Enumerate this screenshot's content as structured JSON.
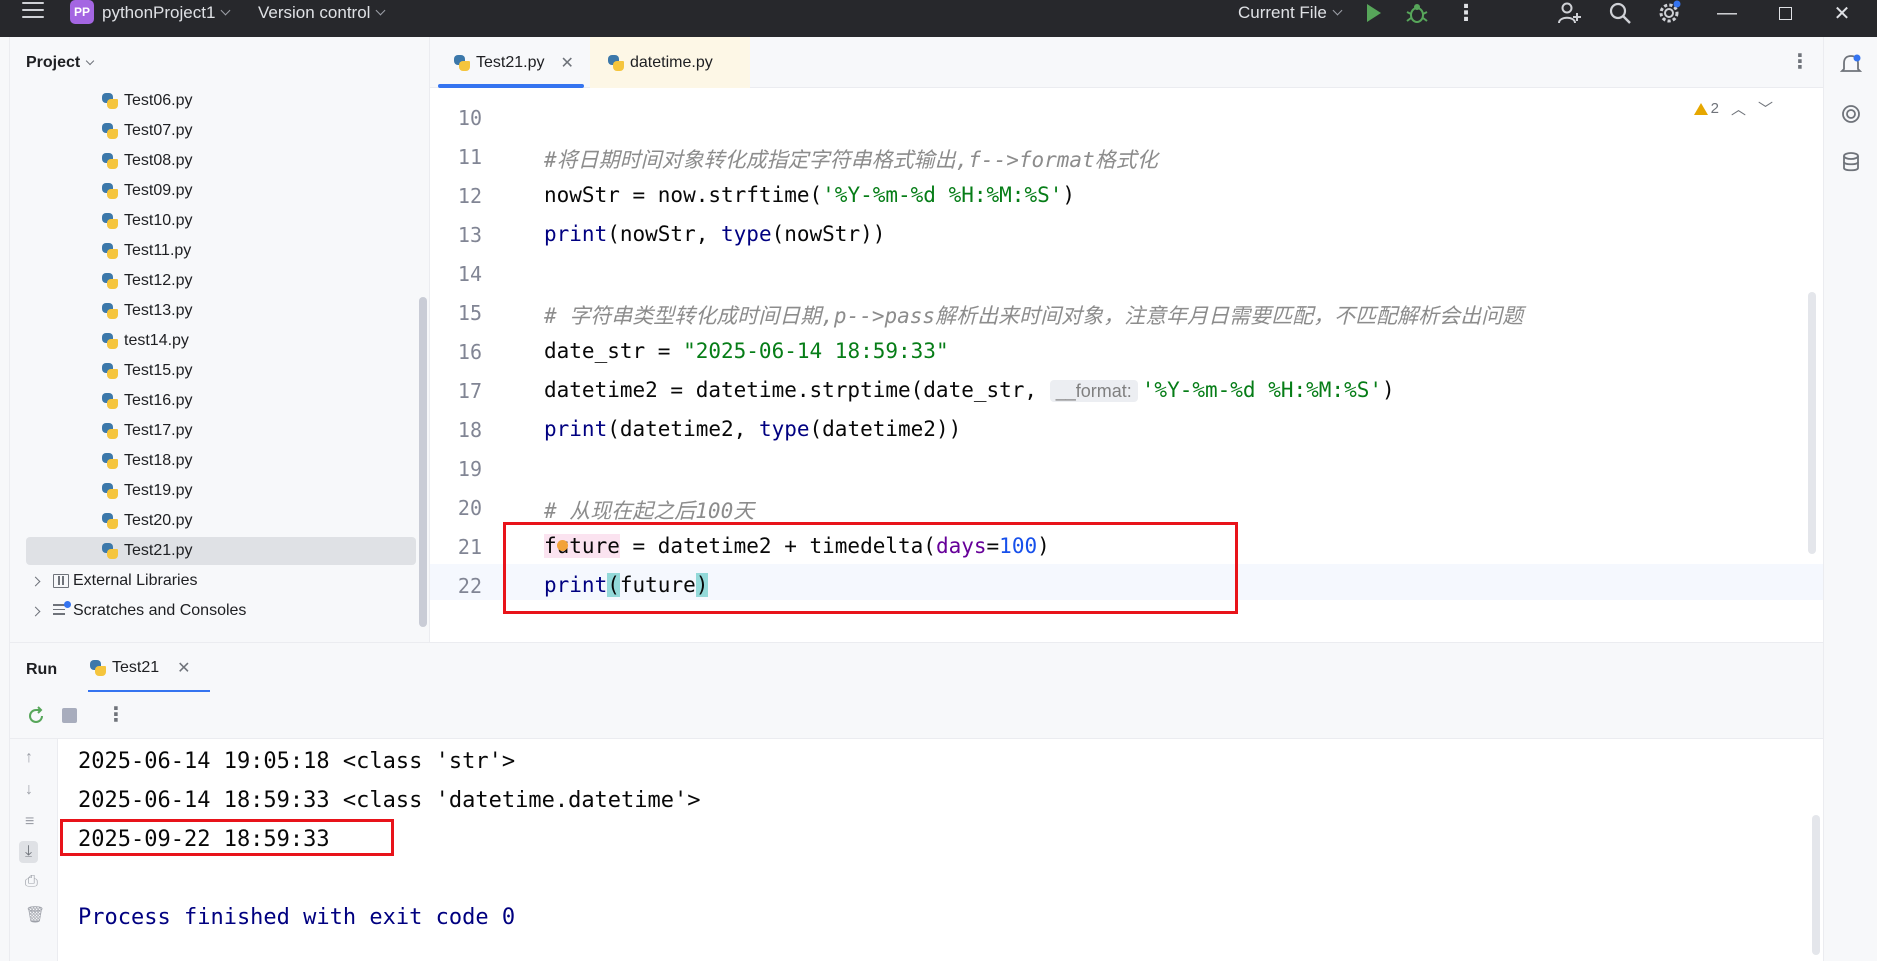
{
  "titlebar": {
    "project_badge": "PP",
    "project_name": "pythonProject1",
    "version_control": "Version control",
    "run_config": "Current File"
  },
  "project_panel": {
    "title": "Project",
    "files": [
      "Test06.py",
      "Test07.py",
      "Test08.py",
      "Test09.py",
      "Test10.py",
      "Test11.py",
      "Test12.py",
      "Test13.py",
      "test14.py",
      "Test15.py",
      "Test16.py",
      "Test17.py",
      "Test18.py",
      "Test19.py",
      "Test20.py",
      "Test21.py"
    ],
    "selected_file": "Test21.py",
    "external_libraries": "External Libraries",
    "scratches": "Scratches and Consoles"
  },
  "editor": {
    "tabs": [
      {
        "label": "Test21.py",
        "active": true
      },
      {
        "label": "datetime.py",
        "active": false
      }
    ],
    "warning_count": "2",
    "line_numbers": [
      "10",
      "11",
      "12",
      "13",
      "14",
      "15",
      "16",
      "17",
      "18",
      "19",
      "20",
      "21",
      "22"
    ],
    "lines": {
      "l11_comment": "#将日期时间对象转化成指定字符串格式输出,f-->format格式化",
      "l12_a": "nowStr = now.strftime(",
      "l12_str": "'%Y-%m-%d %H:%M:%S'",
      "l12_b": ")",
      "l13_kw": "print",
      "l13_a": "(nowStr, ",
      "l13_kw2": "type",
      "l13_b": "(nowStr))",
      "l15_comment": "# 字符串类型转化成时间日期,p-->pass解析出来时间对象，注意年月日需要匹配，不匹配解析会出问题",
      "l16_a": "date_str = ",
      "l16_str": "\"2025-06-14 18:59:33\"",
      "l17_a": "datetime2 = datetime.strptime(date_str, ",
      "l17_hint": "__format:",
      "l17_str": "'%Y-%m-%d %H:%M:%S'",
      "l17_b": ")",
      "l18_kw": "print",
      "l18_a": "(datetime2, ",
      "l18_kw2": "type",
      "l18_b": "(datetime2))",
      "l20_comment": "# 从现在起之后100天",
      "l21_var": "future",
      "l21_a": " = datetime2 + timedelta(",
      "l21_param": "days",
      "l21_eq": "=",
      "l21_num": "100",
      "l21_b": ")",
      "l22_kw": "print",
      "l22_open": "(",
      "l22_arg": "future",
      "l22_close": ")"
    }
  },
  "run_panel": {
    "title": "Run",
    "tab": "Test21",
    "output": [
      "2025-06-14 19:05:18 <class 'str'>",
      "2025-06-14 18:59:33 <class 'datetime.datetime'>",
      "2025-09-22 18:59:33",
      "",
      "Process finished with exit code 0"
    ]
  },
  "colors": {
    "titlebar_bg": "#27282c",
    "accent": "#3574f0",
    "highlight_box": "#e8131a",
    "string": "#067d17",
    "keyword": "#000080"
  }
}
